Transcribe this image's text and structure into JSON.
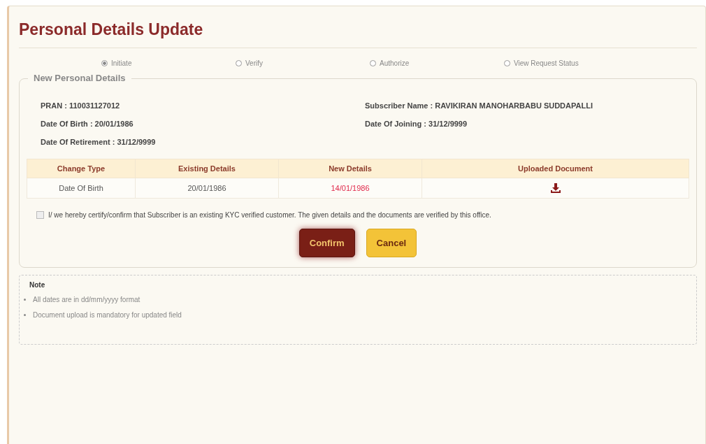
{
  "title": "Personal Details Update",
  "steps": [
    {
      "label": "Initiate",
      "selected": true
    },
    {
      "label": "Verify",
      "selected": false
    },
    {
      "label": "Authorize",
      "selected": false
    },
    {
      "label": "View Request Status",
      "selected": false
    }
  ],
  "section": {
    "legend": "New Personal Details",
    "fields_left": [
      "PRAN : 110031127012",
      "Date Of Birth : 20/01/1986",
      "Date Of Retirement : 31/12/9999"
    ],
    "fields_right": [
      "Subscriber Name : RAVIKIRAN MANOHARBABU SUDDAPALLI",
      "Date Of Joining : 31/12/9999"
    ],
    "table": {
      "columns": [
        "Change Type",
        "Existing Details",
        "New Details",
        "Uploaded Document"
      ],
      "rows": [
        {
          "change_type": "Date Of Birth",
          "existing": "20/01/1986",
          "new": "14/01/1986"
        }
      ]
    },
    "certify": {
      "checked": false,
      "text": "I/ we hereby certify/confirm that Subscriber is an existing KYC verified customer. The given details and the documents are verified by this office."
    },
    "buttons": [
      "Confirm",
      "Cancel"
    ]
  },
  "note": {
    "title": "Note",
    "items": [
      "All dates are in dd/mm/yyyy format",
      "Document upload is mandatory for updated field"
    ]
  }
}
